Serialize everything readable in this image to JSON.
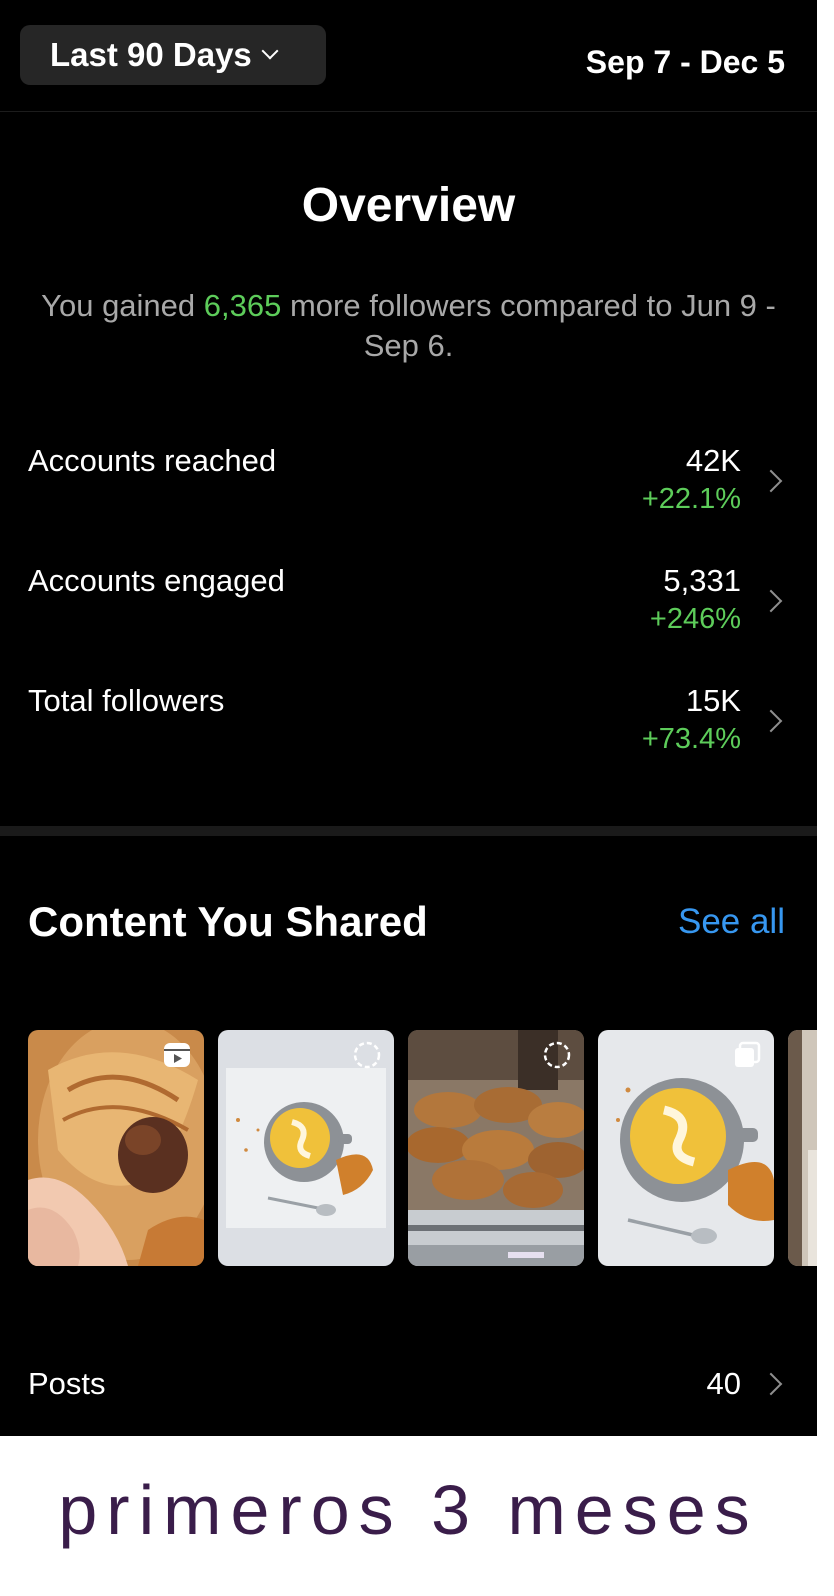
{
  "header": {
    "range_label": "Last 90 Days",
    "date_range": "Sep 7 - Dec 5"
  },
  "overview": {
    "title": "Overview",
    "sub_prefix": "You gained ",
    "sub_gain": "6,365",
    "sub_suffix": " more followers compared to Jun 9 - Sep 6."
  },
  "metrics": [
    {
      "label": "Accounts reached",
      "value": "42K",
      "delta": "+22.1%"
    },
    {
      "label": "Accounts engaged",
      "value": "5,331",
      "delta": "+246%"
    },
    {
      "label": "Total followers",
      "value": "15K",
      "delta": "+73.4%"
    }
  ],
  "content": {
    "title": "Content You Shared",
    "see_all": "See all",
    "thumbnails": [
      {
        "subject": "croissant-chocolate-photo",
        "badge": "reel-icon"
      },
      {
        "subject": "latte-art-photo",
        "badge": "story-ring-icon"
      },
      {
        "subject": "pastries-display-photo",
        "badge": "story-ring-icon"
      },
      {
        "subject": "latte-art-photo",
        "badge": "carousel-icon"
      },
      {
        "subject": "partial-photo",
        "badge": ""
      }
    ]
  },
  "posts": {
    "label": "Posts",
    "value": "40"
  },
  "caption": "primeros 3 meses",
  "colors": {
    "background": "#000000",
    "pill": "#262626",
    "positive": "#5dcc5a",
    "link": "#3797f0",
    "caption": "#3a1d4a"
  }
}
